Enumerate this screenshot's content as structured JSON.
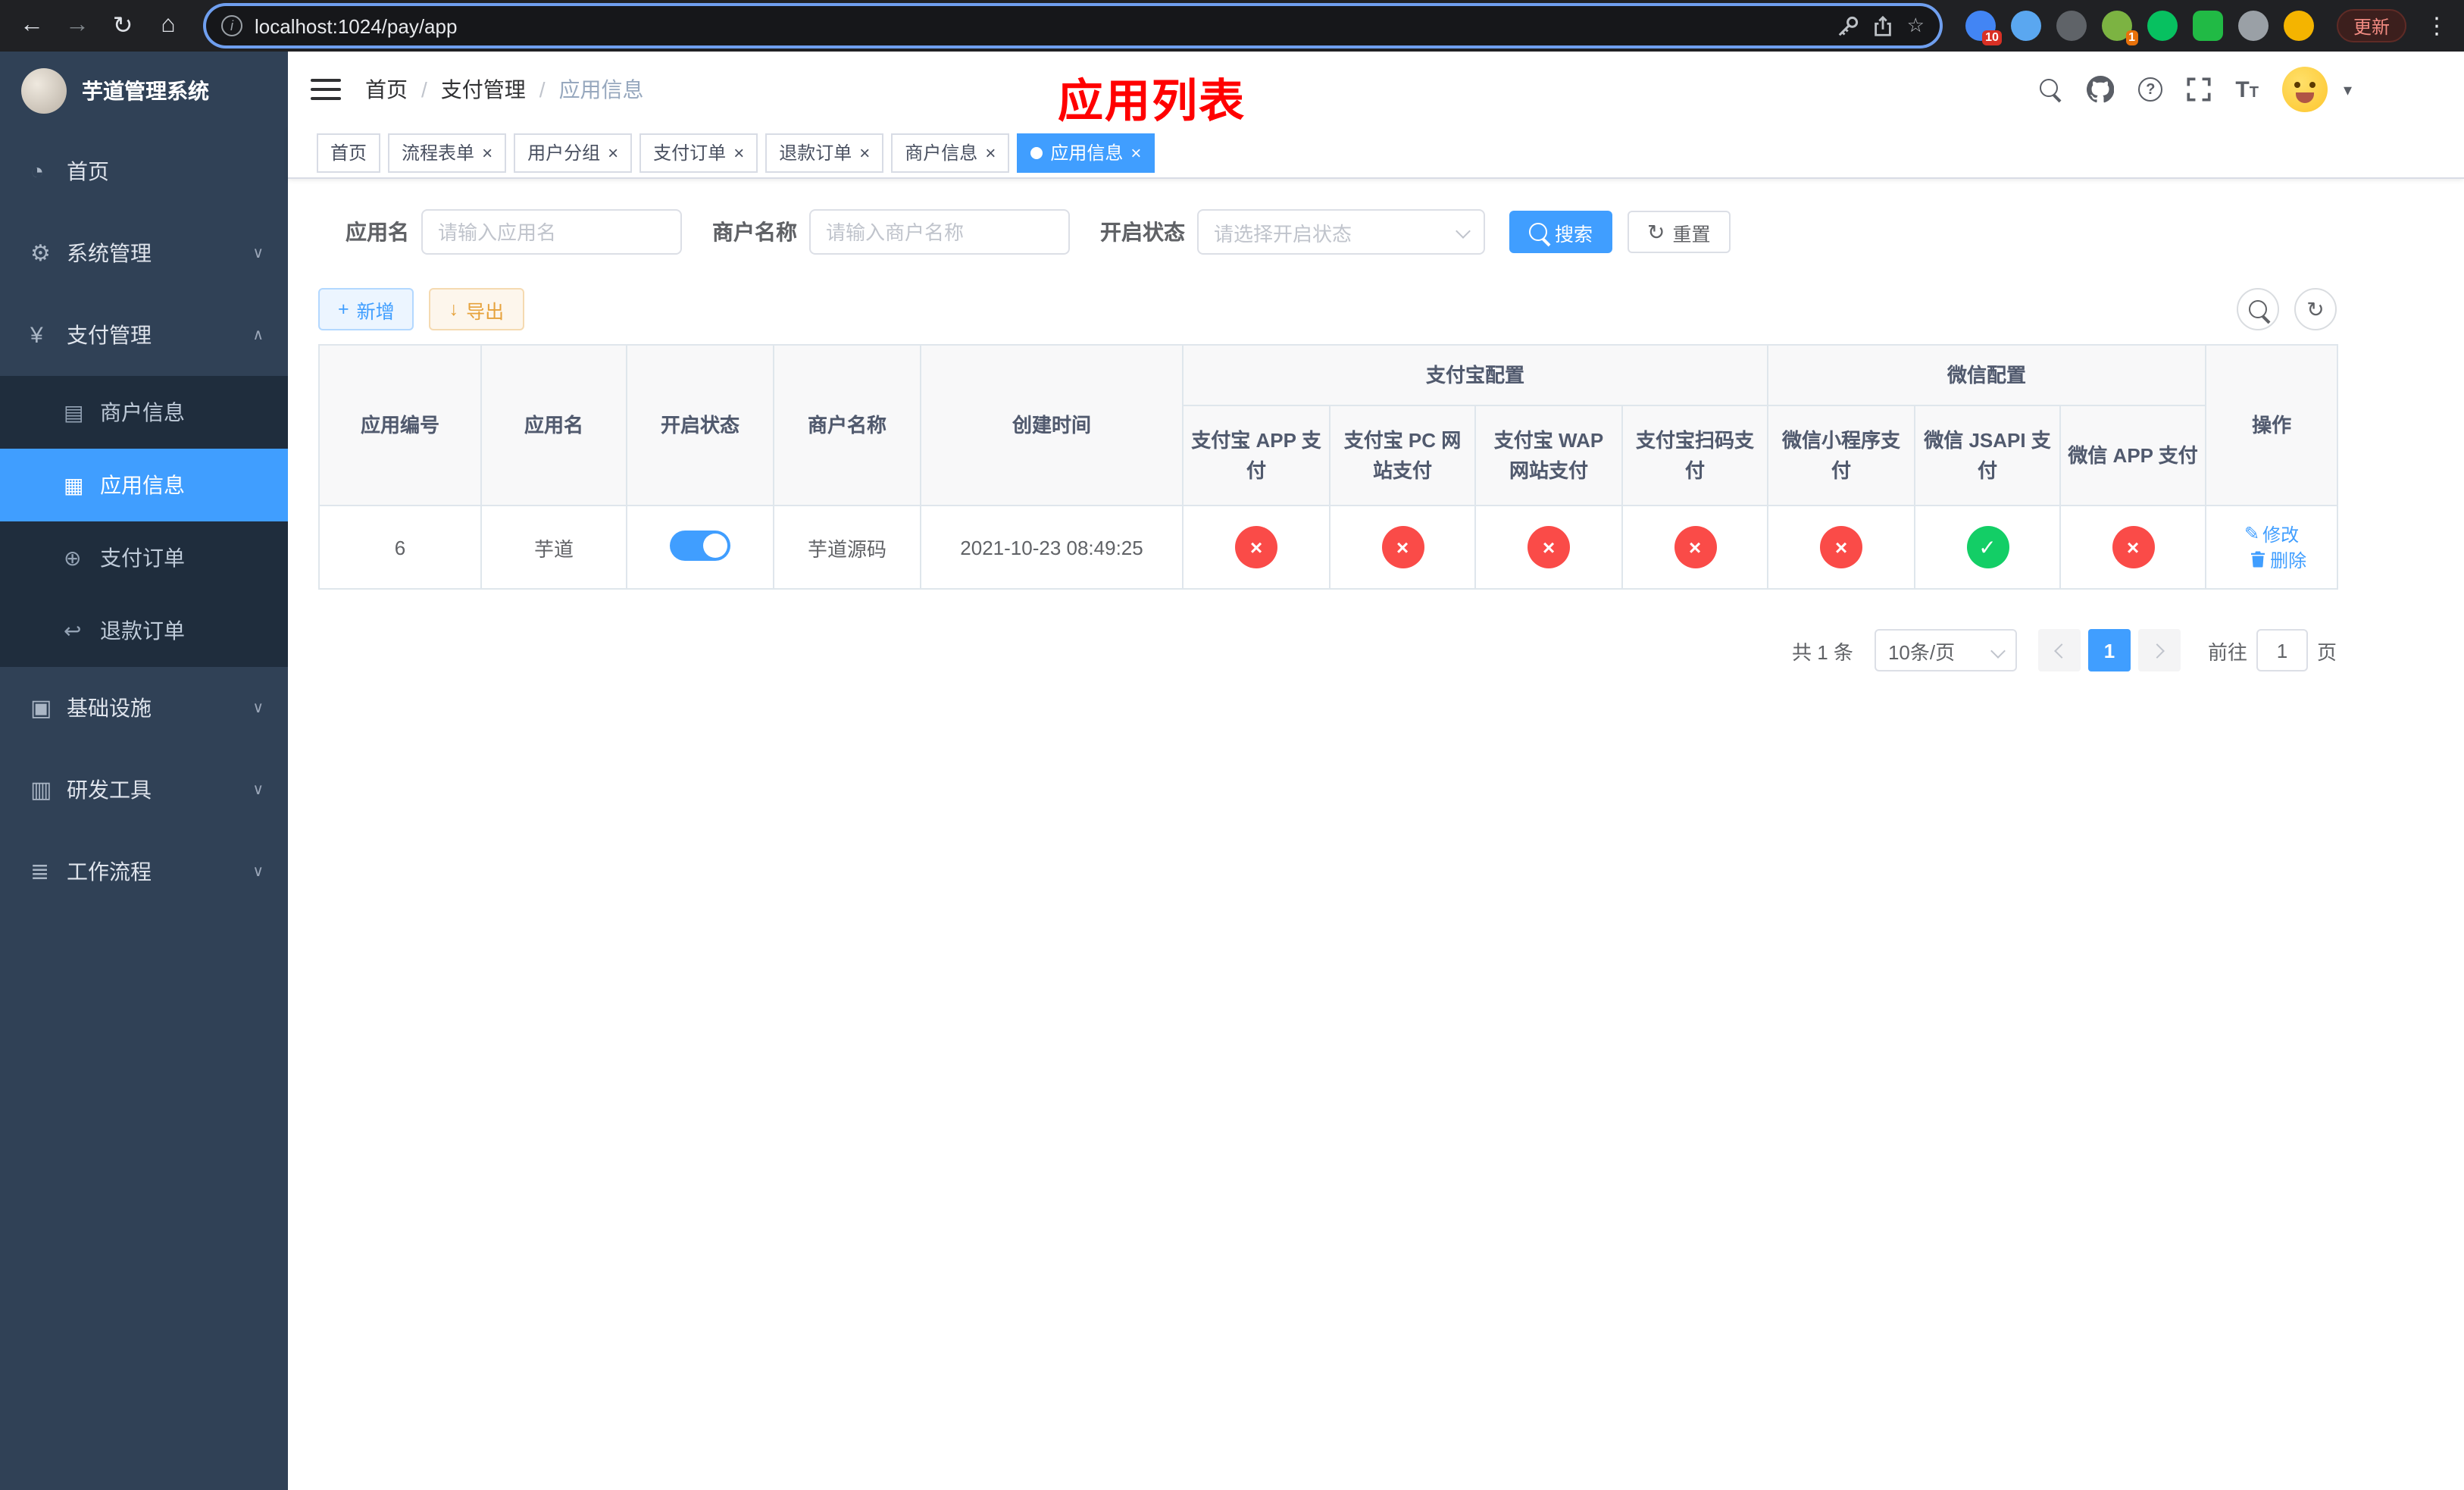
{
  "browser": {
    "url": "localhost:1024/pay/app",
    "update_button": "更新",
    "extension_badges": {
      "puzzle": "10",
      "profile": "1"
    }
  },
  "sidebar": {
    "title": "芋道管理系统",
    "menu": {
      "home": "首页",
      "system": "系统管理",
      "payment": "支付管理",
      "merchant_info": "商户信息",
      "app_info": "应用信息",
      "pay_order": "支付订单",
      "refund_order": "退款订单",
      "infrastructure": "基础设施",
      "dev_tools": "研发工具",
      "workflow": "工作流程"
    }
  },
  "header": {
    "breadcrumb": [
      "首页",
      "支付管理",
      "应用信息"
    ],
    "annotation": "应用列表"
  },
  "tabs": [
    {
      "label": "首页",
      "closable": false,
      "active": false
    },
    {
      "label": "流程表单",
      "closable": true,
      "active": false
    },
    {
      "label": "用户分组",
      "closable": true,
      "active": false
    },
    {
      "label": "支付订单",
      "closable": true,
      "active": false
    },
    {
      "label": "退款订单",
      "closable": true,
      "active": false
    },
    {
      "label": "商户信息",
      "closable": true,
      "active": false
    },
    {
      "label": "应用信息",
      "closable": true,
      "active": true
    }
  ],
  "filter": {
    "app_name_label": "应用名",
    "app_name_placeholder": "请输入应用名",
    "merchant_label": "商户名称",
    "merchant_placeholder": "请输入商户名称",
    "status_label": "开启状态",
    "status_placeholder": "请选择开启状态",
    "search_button": "搜索",
    "reset_button": "重置"
  },
  "toolbar": {
    "add_button": "新增",
    "export_button": "导出"
  },
  "table": {
    "headers": {
      "app_id": "应用编号",
      "app_name": "应用名",
      "status": "开启状态",
      "merchant_name": "商户名称",
      "create_time": "创建时间",
      "alipay_group": "支付宝配置",
      "wechat_group": "微信配置",
      "actions": "操作",
      "alipay_app": "支付宝 APP 支付",
      "alipay_pc": "支付宝 PC 网站支付",
      "alipay_wap": "支付宝 WAP 网站支付",
      "alipay_qr": "支付宝扫码支付",
      "wx_lite": "微信小程序支付",
      "wx_jsapi": "微信 JSAPI 支付",
      "wx_app": "微信 APP 支付"
    },
    "row": {
      "app_id": "6",
      "app_name": "芋道",
      "status_on": true,
      "merchant_name": "芋道源码",
      "create_time": "2021-10-23 08:49:25",
      "configs": [
        false,
        false,
        false,
        false,
        false,
        true,
        false
      ],
      "edit_label": "修改",
      "delete_label": "删除"
    }
  },
  "pagination": {
    "total_text": "共 1 条",
    "page_size": "10条/页",
    "current_page": "1",
    "goto_prefix": "前往",
    "goto_value": "1",
    "goto_suffix": "页"
  },
  "icons": {
    "back": "←",
    "forward": "→",
    "reload": "↻",
    "home": "⌂",
    "star": "☆",
    "menu_dots": "⋮",
    "chev_down": "∨",
    "chev_up": "∧",
    "caret_down": "▾",
    "dashboard": "◔",
    "gear": "⚙",
    "yen": "¥",
    "card": "▤",
    "grid": "▦",
    "order": "⊕",
    "refund": "↩",
    "infra": "▣",
    "tool": "▥",
    "flow": "≣",
    "plus": "+",
    "download": "↓",
    "refresh": "↻",
    "edit": "✎",
    "cross": "×",
    "check": "✓",
    "question": "?",
    "size_big": "T",
    "size_small": "T",
    "info": "i"
  },
  "colors": {
    "accent": "#409eff",
    "danger": "#fa4b48",
    "success": "#13ce66",
    "warning": "#e6a23c",
    "annotation_red": "#ff0000",
    "sidebar_bg": "#304156",
    "submenu_bg": "#1f2d3d"
  }
}
